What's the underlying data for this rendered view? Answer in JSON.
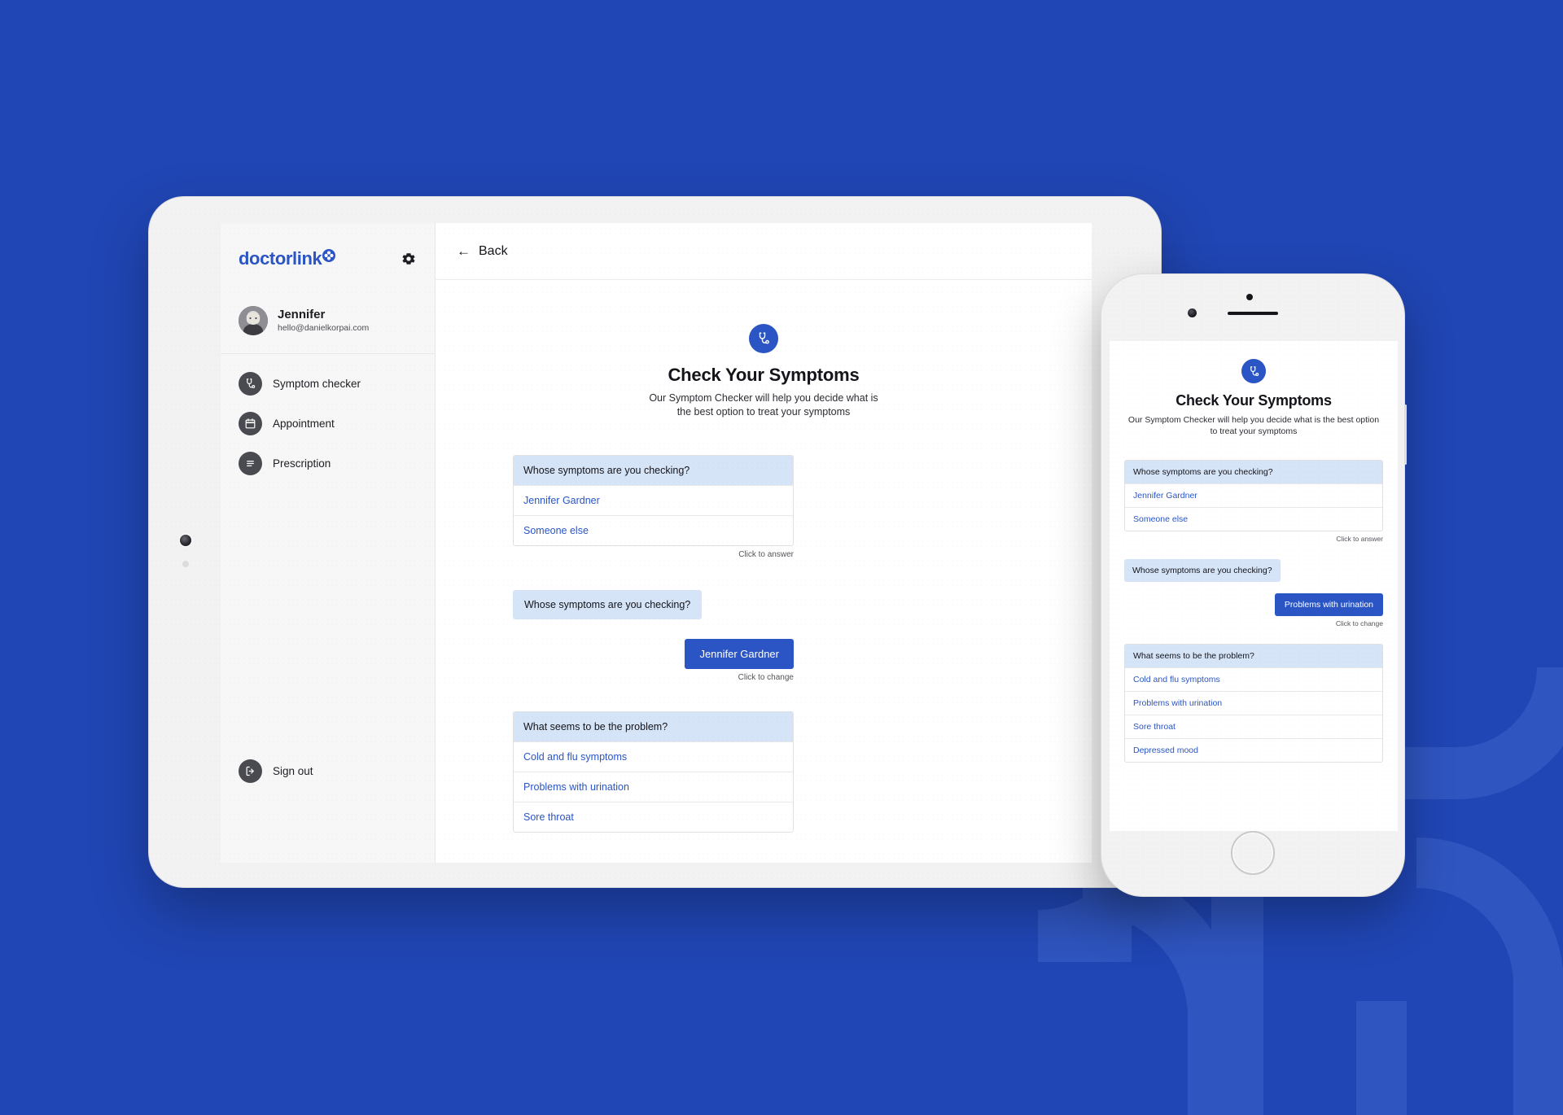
{
  "theme": {
    "background_blue": "#2046B5",
    "accent_blue": "#2B55C4",
    "question_header_blue": "#D6E4F7",
    "icon_circle_gray": "#4A4A51"
  },
  "tablet": {
    "sidebar": {
      "brand": "doctorlink",
      "brand_mark_icon": "doctorlink-cross-icon",
      "settings_icon": "gear-icon",
      "profile": {
        "avatar_icon": "user-avatar",
        "name": "Jennifer",
        "email": "hello@danielkorpai.com"
      },
      "items": [
        {
          "label": "Symptom checker",
          "icon": "stethoscope-icon"
        },
        {
          "label": "Appointment",
          "icon": "calendar-icon"
        },
        {
          "label": "Prescription",
          "icon": "document-lines-icon"
        }
      ],
      "signout": {
        "label": "Sign out",
        "icon": "sign-out-icon"
      }
    },
    "topbar": {
      "back_arrow": "←",
      "back_label": "Back"
    },
    "hero": {
      "badge_icon": "stethoscope-icon",
      "title": "Check Your Symptoms",
      "subtitle": "Our Symptom Checker will help you decide what is the best option to treat your symptoms"
    },
    "chat": {
      "block1": {
        "question": "Whose symptoms are you checking?",
        "options": [
          "Jennifer Gardner",
          "Someone else"
        ],
        "hint": "Click to answer"
      },
      "block2": {
        "question": "Whose symptoms are you checking?",
        "answer": "Jennifer Gardner",
        "hint": "Click to change"
      },
      "block3": {
        "question": "What seems to be the problem?",
        "options": [
          "Cold and flu symptoms",
          "Problems with urination",
          "Sore throat"
        ]
      }
    }
  },
  "phone": {
    "hero": {
      "badge_icon": "stethoscope-icon",
      "title": "Check Your Symptoms",
      "subtitle": "Our Symptom Checker will help you decide what is the best option to treat your symptoms"
    },
    "chat": {
      "block1": {
        "question": "Whose symptoms are you checking?",
        "options": [
          "Jennifer Gardner",
          "Someone else"
        ],
        "hint": "Click to answer"
      },
      "block2": {
        "question": "Whose symptoms are you checking?",
        "answer": "Problems with urination",
        "hint": "Click to change"
      },
      "block3": {
        "question": "What seems to be the problem?",
        "options": [
          "Cold and flu symptoms",
          "Problems with urination",
          "Sore throat",
          "Depressed mood"
        ]
      }
    }
  }
}
